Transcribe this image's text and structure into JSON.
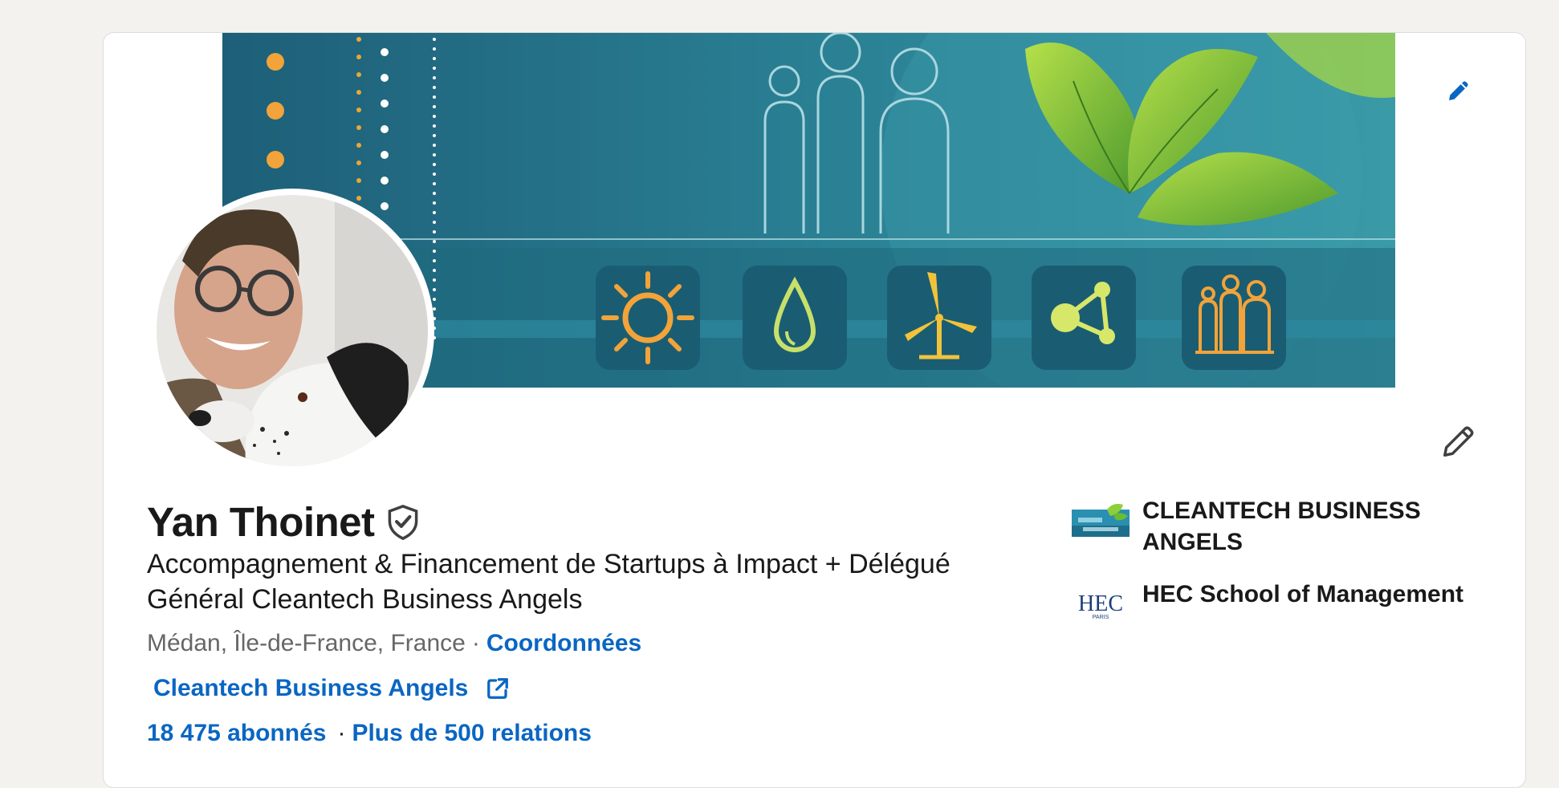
{
  "profile": {
    "name": "Yan Thoinet",
    "verified_icon": "shield-check-icon",
    "headline": "Accompagnement & Financement de Startups à Impact + Délégué Général Cleantech Business Angels",
    "location": "Médan, Île-de-France, France",
    "separator": "·",
    "contact_label": "Coordonnées",
    "website_label": "Cleantech Business Angels",
    "website_icon": "external-link-icon",
    "followers_label": "18 475 abonnés",
    "connections_label": "Plus de 500 relations"
  },
  "organizations": [
    {
      "name": "CLEANTECH BUSINESS ANGELS",
      "logo_icon": "cleantech-logo"
    },
    {
      "name": "HEC School of Management",
      "logo_icon": "hec-paris-logo",
      "logo_text": "HEC",
      "logo_subtext": "PARIS"
    }
  ],
  "banner": {
    "icons": [
      "sun-icon",
      "water-drop-icon",
      "wind-turbine-icon",
      "molecule-icon",
      "people-icon"
    ]
  },
  "actions": {
    "edit_cover_icon": "pencil-icon",
    "edit_intro_icon": "pencil-icon"
  },
  "colors": {
    "link": "#0a66c2",
    "banner_teal": "#2a7a8e",
    "accent_orange": "#f2a33a"
  }
}
